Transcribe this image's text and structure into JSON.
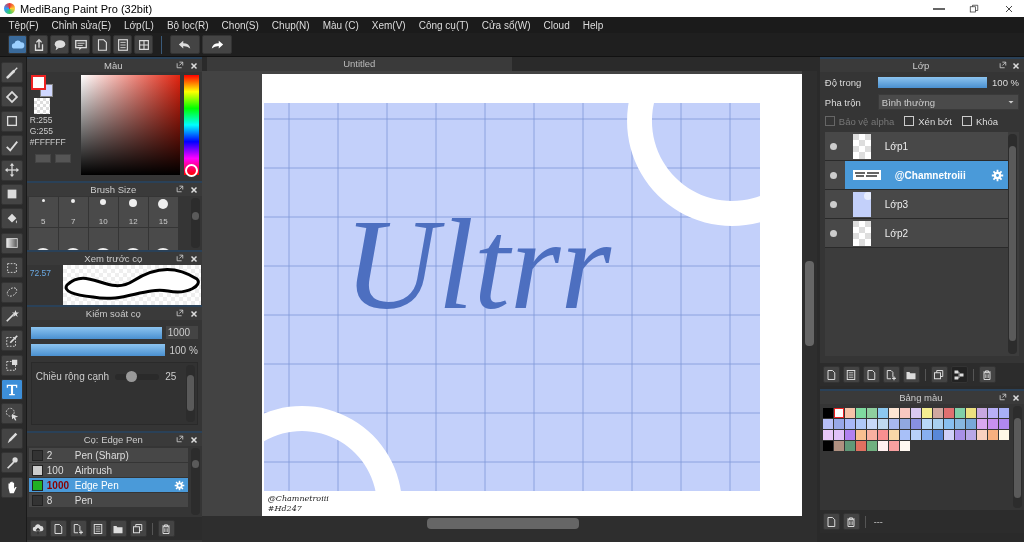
{
  "window": {
    "title": "MediBang Paint Pro (32bit)"
  },
  "menu": [
    "Tệp(F)",
    "Chỉnh sửa(E)",
    "Lớp(L)",
    "Bộ lọc(R)",
    "Chọn(S)",
    "Chụp(N)",
    "Màu (C)",
    "Xem(V)",
    "Công cụ(T)",
    "Cửa sổ(W)",
    "Cloud",
    "Help"
  ],
  "toolbar": [
    {
      "kind": "cloud",
      "selected": true
    },
    {
      "kind": "share",
      "selected": false
    },
    {
      "kind": "bubble",
      "selected": false
    },
    {
      "kind": "comment",
      "selected": false
    },
    {
      "kind": "page",
      "selected": false
    },
    {
      "kind": "list",
      "selected": false
    },
    {
      "kind": "grid",
      "selected": false
    },
    {
      "kind": "undo",
      "selected": false
    },
    {
      "kind": "redo",
      "selected": false
    }
  ],
  "tools": [
    {
      "kind": "brush",
      "selected": false
    },
    {
      "kind": "eraser",
      "selected": false
    },
    {
      "kind": "rect",
      "selected": false
    },
    {
      "kind": "line",
      "selected": false
    },
    {
      "kind": "move",
      "selected": false
    },
    {
      "kind": "fill",
      "selected": false
    },
    {
      "kind": "bucket",
      "selected": false
    },
    {
      "kind": "gradient",
      "selected": false
    },
    {
      "kind": "select",
      "selected": false
    },
    {
      "kind": "lasso",
      "selected": false
    },
    {
      "kind": "wand",
      "selected": false
    },
    {
      "kind": "selpen",
      "selected": false
    },
    {
      "kind": "seleraser",
      "selected": false
    },
    {
      "kind": "text",
      "selected": true
    },
    {
      "kind": "autoselect",
      "selected": false
    },
    {
      "kind": "knife",
      "selected": false
    },
    {
      "kind": "eyedropper",
      "selected": false
    },
    {
      "kind": "hand",
      "selected": false
    }
  ],
  "color_panel": {
    "title": "Màu",
    "readouts": [
      "R:255",
      "G:255"
    ],
    "hex": "#FFFFFF"
  },
  "brush_size": {
    "title": "Brush Size",
    "sizes": [
      "5",
      "7",
      "10",
      "12",
      "15"
    ]
  },
  "brush_preview": {
    "title": "Xem trước cọ",
    "zoom": "72.57"
  },
  "brush_control": {
    "title": "Kiểm soát cọ",
    "size": {
      "level": 1,
      "value": "1000"
    },
    "opacity": {
      "level": 1,
      "value": "100 %"
    },
    "edge_width": {
      "label": "Chiều rộng cạnh",
      "level": 0.35,
      "value": "25"
    }
  },
  "brush_list": {
    "title": "Cọ: Edge Pen",
    "brushes": [
      {
        "size": "2",
        "name": "Pen (Sharp)",
        "color": "#333333",
        "selected": false
      },
      {
        "size": "100",
        "name": "Airbrush",
        "color": "#cccccc",
        "selected": false
      },
      {
        "size": "1000",
        "name": "Edge Pen",
        "color": "#22b022",
        "selected": true
      },
      {
        "size": "8",
        "name": "Pen",
        "color": "#333333",
        "selected": false
      }
    ]
  },
  "canvas": {
    "tab": "Untitled",
    "lettering": "Ultrr",
    "signature": [
      "@Chamnetroiii",
      "#Hd247"
    ]
  },
  "layer_panel": {
    "title": "Lớp",
    "opacity": {
      "label": "Độ trong",
      "level": 1,
      "value": "100 %"
    },
    "blend": {
      "label": "Pha trộn",
      "value": "Bình thường"
    },
    "options": [
      {
        "label": "Bảo vệ alpha",
        "checked": false,
        "disabled": true
      },
      {
        "label": "Xén bớt",
        "checked": false,
        "disabled": false
      },
      {
        "label": "Khóa",
        "checked": false,
        "disabled": false
      }
    ],
    "layers": [
      {
        "name": "Lớp1",
        "kind": "empty",
        "selected": false
      },
      {
        "name": "@Chamnetroiii",
        "kind": "text",
        "selected": true
      },
      {
        "name": "Lớp3",
        "kind": "fill",
        "selected": false
      },
      {
        "name": "Lớp2",
        "kind": "empty",
        "selected": false
      }
    ]
  },
  "palette": {
    "title": "Bảng màu",
    "status": "---",
    "swatches": [
      {
        "color": "#000000",
        "selected": false
      },
      {
        "color": "#ffffff",
        "selected": true
      },
      {
        "color": "#f6c3a8",
        "selected": false
      },
      {
        "color": "#7fdba0",
        "selected": false
      },
      {
        "color": "#8fcf9f",
        "selected": false
      },
      {
        "color": "#8cc8f0",
        "selected": false
      },
      {
        "color": "#fde5d3",
        "selected": false
      },
      {
        "color": "#f8c8c0",
        "selected": false
      },
      {
        "color": "#d8c8f0",
        "selected": false
      },
      {
        "color": "#f5ee90",
        "selected": false
      },
      {
        "color": "#d0a8a0",
        "selected": false
      },
      {
        "color": "#e07070",
        "selected": false
      },
      {
        "color": "#80cfa8",
        "selected": false
      },
      {
        "color": "#ede080",
        "selected": false
      },
      {
        "color": "#c8a8e0",
        "selected": false
      },
      {
        "color": "#b8b0f8",
        "selected": false
      },
      {
        "color": "#a8b0f8",
        "selected": false
      },
      {
        "color": "#b8c0f8",
        "selected": false
      },
      {
        "color": "#98a8e8",
        "selected": false
      },
      {
        "color": "#a8b8f8",
        "selected": false
      },
      {
        "color": "#b0c8f8",
        "selected": false
      },
      {
        "color": "#c8d8f8",
        "selected": false
      },
      {
        "color": "#c0d8f0",
        "selected": false
      },
      {
        "color": "#a8b8f0",
        "selected": false
      },
      {
        "color": "#90a8e0",
        "selected": false
      },
      {
        "color": "#8890e0",
        "selected": false
      },
      {
        "color": "#b8d8f8",
        "selected": false
      },
      {
        "color": "#a8d0f0",
        "selected": false
      },
      {
        "color": "#88c0f0",
        "selected": false
      },
      {
        "color": "#88b8e0",
        "selected": false
      },
      {
        "color": "#78a8d8",
        "selected": false
      },
      {
        "color": "#d8a8f0",
        "selected": false
      },
      {
        "color": "#c890f0",
        "selected": false
      },
      {
        "color": "#b088f0",
        "selected": false
      },
      {
        "color": "#e8c8f8",
        "selected": false
      },
      {
        "color": "#e0c0f8",
        "selected": false
      },
      {
        "color": "#b080f0",
        "selected": false
      },
      {
        "color": "#f8c090",
        "selected": false
      },
      {
        "color": "#f8b0a0",
        "selected": false
      },
      {
        "color": "#f89090",
        "selected": false
      },
      {
        "color": "#f8d8a8",
        "selected": false
      },
      {
        "color": "#a8c0f8",
        "selected": false
      },
      {
        "color": "#b8d0f8",
        "selected": false
      },
      {
        "color": "#88b0f0",
        "selected": false
      },
      {
        "color": "#5888d8",
        "selected": false
      },
      {
        "color": "#d0d0f8",
        "selected": false
      },
      {
        "color": "#a890e8",
        "selected": false
      },
      {
        "color": "#b8a8e8",
        "selected": false
      },
      {
        "color": "#f8d0c0",
        "selected": false
      },
      {
        "color": "#f8b080",
        "selected": false
      },
      {
        "color": "#fff8e8",
        "selected": false
      },
      {
        "color": "#010101",
        "selected": false
      },
      {
        "color": "#b09080",
        "selected": false
      },
      {
        "color": "#609878",
        "selected": false
      },
      {
        "color": "#e07060",
        "selected": false
      },
      {
        "color": "#70b080",
        "selected": false
      },
      {
        "color": "#fff0f0",
        "selected": false
      },
      {
        "color": "#f8a0a0",
        "selected": false
      },
      {
        "color": "#fff8f0",
        "selected": false
      }
    ]
  }
}
